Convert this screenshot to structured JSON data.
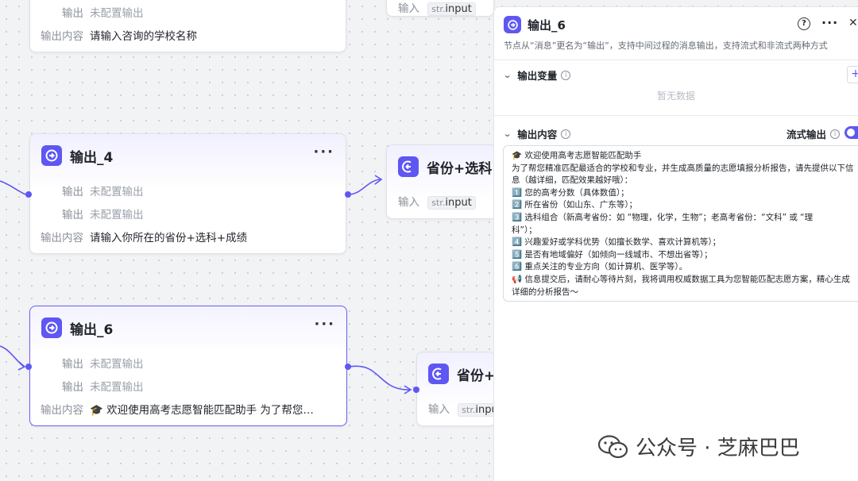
{
  "canvas": {
    "top_node": {
      "row_output_label": "输出",
      "row_output_value": "未配置输出",
      "content_label": "输出内容",
      "content_value": "请输入咨询的学校名称"
    },
    "top_input_node": {
      "input_label": "输入",
      "tag_type": "str.",
      "tag_value": "input"
    },
    "node4": {
      "title": "输出_4",
      "more": "···",
      "rows": [
        {
          "label": "输出",
          "value": "未配置输出"
        },
        {
          "label": "输出",
          "value": "未配置输出"
        }
      ],
      "content_label": "输出内容",
      "content_value": "请输入你所在的省份+选科+成绩"
    },
    "node_province1": {
      "title": "省份+选科",
      "input_label": "输入",
      "tag_type": "str.",
      "tag_value": "input"
    },
    "node6": {
      "title": "输出_6",
      "more": "···",
      "rows": [
        {
          "label": "输出",
          "value": "未配置输出"
        },
        {
          "label": "输出",
          "value": "未配置输出"
        }
      ],
      "content_label": "输出内容",
      "content_value": "🎓 欢迎使用高考志愿智能匹配助手 为了帮您…"
    },
    "node_province2": {
      "title": "省份+",
      "input_label": "输入",
      "tag_type": "str.",
      "tag_value": "inpu"
    }
  },
  "panel": {
    "title": "输出_6",
    "help_icon": "?",
    "more": "···",
    "close": "✕",
    "description": "节点从“消息”更名为“输出”，支持中间过程的消息输出，支持流式和非流式两种方式",
    "vars_section": "输出变量",
    "add_label": "+",
    "empty_text": "暂无数据",
    "content_section": "输出内容",
    "stream_label": "流式输出",
    "stream_on": true,
    "content_lines": [
      "🎓 欢迎使用高考志愿智能匹配助手",
      "为了帮您精准匹配最适合的学校和专业，并生成高质量的志愿填报分析报告，请先提供以下信",
      "息（越详细，匹配效果越好哦）：",
      "1️⃣ 您的高考分数（具体数值）；",
      "2️⃣ 所在省份（如山东、广东等）；",
      "3️⃣ 选科组合（新高考省份：如 “物理，化学，生物”；老高考省份：“文科” 或 “理",
      "科”）；",
      "4️⃣ 兴趣爱好或学科优势（如擅长数学、喜欢计算机等）；",
      "5️⃣ 是否有地域偏好（如倾向一线城市、不想出省等）；",
      "6️⃣ 重点关注的专业方向（如计算机、医学等）。",
      "📢 信息提交后，请耐心等待片刻，我将调用权威数据工具为您智能匹配志愿方案，精心生成",
      "详细的分析报告～"
    ]
  },
  "watermark": {
    "text": "公众号 · 芝麻巴巴"
  },
  "colors": {
    "accent": "#5e57f2",
    "selected_border": "#6b5ef5",
    "canvas_bg": "#f2f3f5"
  }
}
